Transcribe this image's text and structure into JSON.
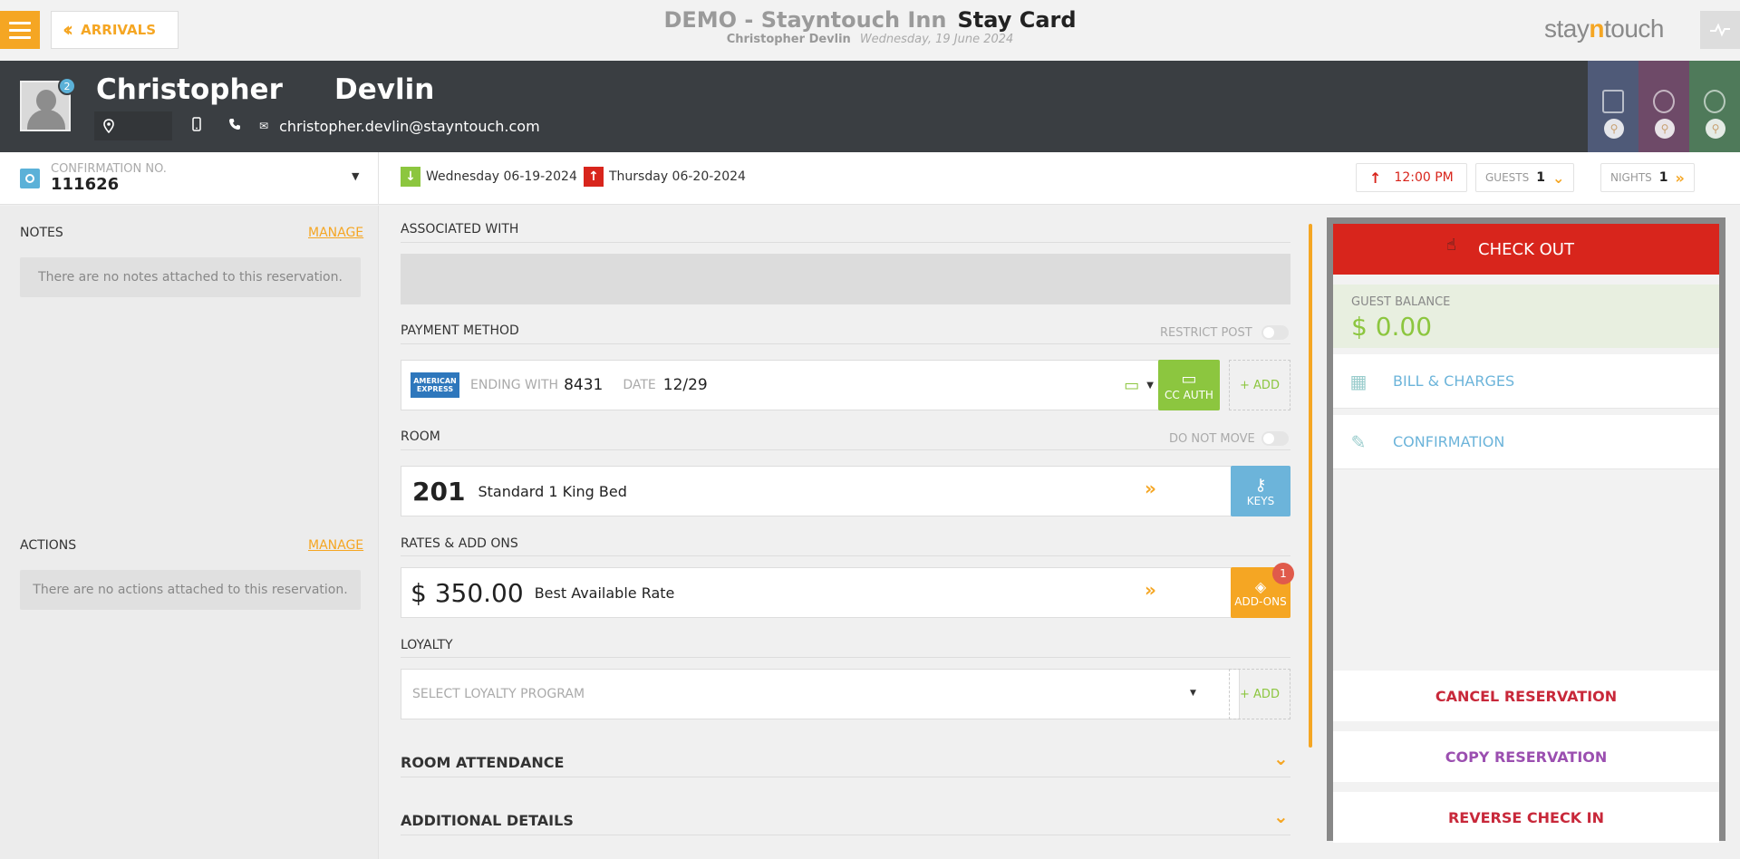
{
  "topbar": {
    "back_label": "ARRIVALS",
    "hotel_name": "DEMO - Stayntouch Inn",
    "page_title": "Stay Card",
    "guest_name": "Christopher Devlin",
    "date": "Wednesday, 19 June 2024",
    "brand_pre": "stay",
    "brand_n": "n",
    "brand_post": "touch"
  },
  "guest": {
    "first_name": "Christopher",
    "last_name": "Devlin",
    "email": "christopher.devlin@stayntouch.com",
    "avatar_badge": "2",
    "tile_colors": [
      "#4a5a7a",
      "#7a4a6a",
      "#4a7a5a"
    ]
  },
  "info": {
    "conf_label": "CONFIRMATION NO.",
    "conf_number": "111626",
    "arrival": "Wednesday 06-19-2024",
    "departure": "Thursday 06-20-2024",
    "departure_time": "12:00 PM",
    "guests_label": "GUESTS",
    "guests_value": "1",
    "nights_label": "NIGHTS",
    "nights_value": "1"
  },
  "left": {
    "notes_label": "NOTES",
    "notes_manage": "MANAGE",
    "notes_empty": "There are no notes attached to this reservation.",
    "actions_label": "ACTIONS",
    "actions_manage": "MANAGE",
    "actions_empty": "There are no actions attached to this reservation."
  },
  "center": {
    "associated_label": "ASSOCIATED WITH",
    "payment_label": "PAYMENT METHOD",
    "restrict_post": "RESTRICT POST",
    "card_brand": "AMERICAN EXPRESS",
    "ending_label": "ENDING WITH",
    "ending_value": "8431",
    "date_label": "DATE",
    "date_value": "12/29",
    "cc_auth": "CC AUTH",
    "add_label": "+ ADD",
    "room_label": "ROOM",
    "do_not_move": "DO NOT MOVE",
    "room_number": "201",
    "room_type": "Standard 1 King Bed",
    "keys_label": "KEYS",
    "rates_label": "RATES & ADD ONS",
    "rate_amount": "$ 350.00",
    "rate_name": "Best Available Rate",
    "addons_label": "ADD-ONS",
    "addons_count": "1",
    "loyalty_label": "LOYALTY",
    "loyalty_placeholder": "SELECT LOYALTY PROGRAM",
    "room_attendance": "ROOM ATTENDANCE",
    "additional_details": "ADDITIONAL DETAILS"
  },
  "right": {
    "checkout": "CHECK OUT",
    "balance_label": "GUEST BALANCE",
    "balance_value": "$ 0.00",
    "bill_label": "BILL & CHARGES",
    "confirmation_label": "CONFIRMATION",
    "cancel": "CANCEL RESERVATION",
    "copy": "COPY RESERVATION",
    "reverse": "REVERSE CHECK IN"
  },
  "colors": {
    "accent": "#f5a623",
    "checkout_red": "#d8251c",
    "cancel_red": "#c8283a",
    "copy_purple": "#9b4fb0",
    "link_blue": "#6cb4da",
    "green": "#8cc63f"
  }
}
